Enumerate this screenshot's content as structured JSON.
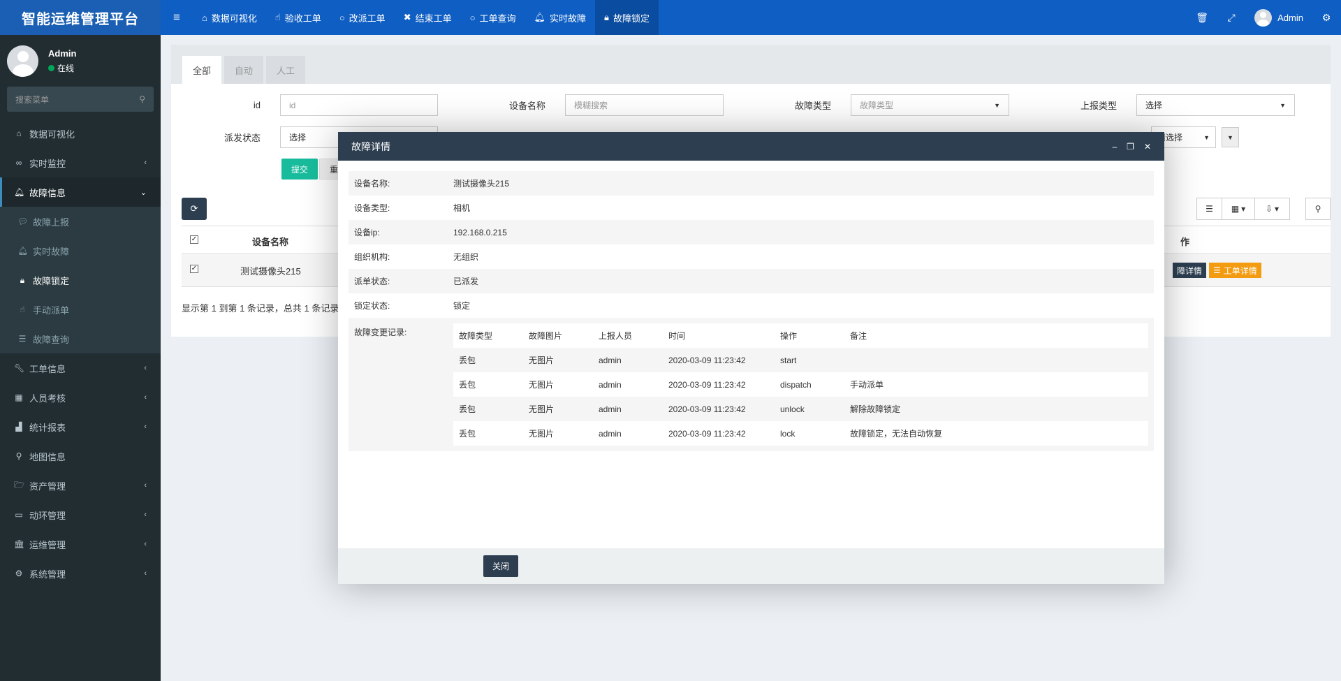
{
  "brand": {
    "title": "智能运维管理平台"
  },
  "topnav": {
    "items": [
      {
        "label": "数据可视化",
        "icon": "home-icon"
      },
      {
        "label": "验收工单",
        "icon": "thumbs-up-icon"
      },
      {
        "label": "改派工单",
        "icon": "circle-icon"
      },
      {
        "label": "结束工单",
        "icon": "close-icon"
      },
      {
        "label": "工单查询",
        "icon": "circle-icon"
      },
      {
        "label": "实时故障",
        "icon": "bell-icon"
      },
      {
        "label": "故障锁定",
        "icon": "lock-icon"
      }
    ],
    "user": "Admin"
  },
  "sidebar": {
    "user_name": "Admin",
    "user_status": "在线",
    "search_placeholder": "搜索菜单",
    "items": [
      {
        "label": "数据可视化"
      },
      {
        "label": "实时监控"
      },
      {
        "label": "故障信息"
      },
      {
        "label": "工单信息"
      },
      {
        "label": "人员考核"
      },
      {
        "label": "统计报表"
      },
      {
        "label": "地图信息"
      },
      {
        "label": "资产管理"
      },
      {
        "label": "动环管理"
      },
      {
        "label": "运维管理"
      },
      {
        "label": "系统管理"
      }
    ],
    "sub_items": [
      {
        "label": "故障上报"
      },
      {
        "label": "实时故障"
      },
      {
        "label": "故障锁定"
      },
      {
        "label": "手动派单"
      },
      {
        "label": "故障查询"
      }
    ]
  },
  "tabs": [
    "全部",
    "自动",
    "人工"
  ],
  "filters": {
    "id_label": "id",
    "id_placeholder": "id",
    "device_label": "设备名称",
    "device_placeholder": "模糊搜索",
    "fault_type_label": "故障类型",
    "fault_type_placeholder": "故障类型",
    "report_type_label": "上报类型",
    "report_type_value": "选择",
    "dispatch_label": "派发状态",
    "dispatch_value": "选择",
    "extra_value": "请选择",
    "submit": "提交",
    "reset": "重"
  },
  "table": {
    "col_name": "设备名称",
    "col_action": "作",
    "row_name": "测试摄像头215",
    "btn_fault": "障详情",
    "btn_order": "工单详情",
    "pager": "显示第 1 到第 1 条记录，总共 1 条记录"
  },
  "modal": {
    "title": "故障详情",
    "fields": [
      {
        "key": "设备名称:",
        "value": "测试摄像头215"
      },
      {
        "key": "设备类型:",
        "value": "相机"
      },
      {
        "key": "设备ip:",
        "value": "192.168.0.215"
      },
      {
        "key": "组织机构:",
        "value": "无组织"
      },
      {
        "key": "派单状态:",
        "value": "已派发"
      },
      {
        "key": "锁定状态:",
        "value": "锁定"
      }
    ],
    "log_label": "故障变更记录:",
    "log_headers": [
      "故障类型",
      "故障图片",
      "上报人员",
      "时间",
      "操作",
      "备注"
    ],
    "log_rows": [
      [
        "丢包",
        "无图片",
        "admin",
        "2020-03-09 11:23:42",
        "start",
        ""
      ],
      [
        "丢包",
        "无图片",
        "admin",
        "2020-03-09 11:23:42",
        "dispatch",
        "手动派单"
      ],
      [
        "丢包",
        "无图片",
        "admin",
        "2020-03-09 11:23:42",
        "unlock",
        "解除故障锁定"
      ],
      [
        "丢包",
        "无图片",
        "admin",
        "2020-03-09 11:23:42",
        "lock",
        "故障锁定，无法自动恢复"
      ]
    ],
    "close_label": "关闭"
  }
}
